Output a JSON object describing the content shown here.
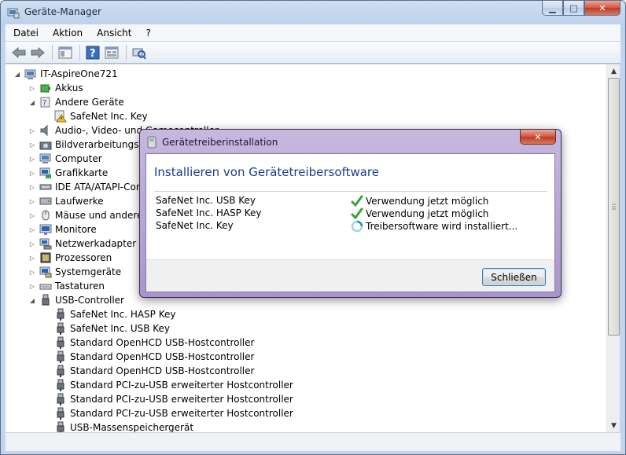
{
  "window": {
    "title": "Geräte-Manager",
    "controls": [
      "minimize-icon",
      "maximize-icon",
      "close-icon"
    ]
  },
  "menu": [
    "Datei",
    "Aktion",
    "Ansicht",
    "?"
  ],
  "toolbar": [
    "back-icon",
    "forward-icon",
    "properties-icon",
    "help-icon",
    "show-hidden-icon",
    "scan-hardware-icon"
  ],
  "tree": {
    "root": "IT-AspireOne721",
    "nodes": [
      {
        "label": "Akkus",
        "icon": "battery-icon",
        "expanded": false
      },
      {
        "label": "Andere Geräte",
        "icon": "unknown-device-icon",
        "expanded": true,
        "children": [
          {
            "label": "SafeNet Inc. Key",
            "icon": "warning-device-icon"
          }
        ]
      },
      {
        "label": "Audio-, Video- und Gamecontroller",
        "icon": "speaker-icon",
        "expanded": false
      },
      {
        "label": "Bildverarbeitungsgeräte",
        "icon": "camera-icon",
        "expanded": false
      },
      {
        "label": "Computer",
        "icon": "computer-icon",
        "expanded": false
      },
      {
        "label": "Grafikkarte",
        "icon": "display-adapter-icon",
        "expanded": false
      },
      {
        "label": "IDE ATA/ATAPI-Controller",
        "icon": "ide-controller-icon",
        "expanded": false
      },
      {
        "label": "Laufwerke",
        "icon": "disk-drive-icon",
        "expanded": false
      },
      {
        "label": "Mäuse und andere Zeigegeräte",
        "icon": "mouse-icon",
        "expanded": false
      },
      {
        "label": "Monitore",
        "icon": "monitor-icon",
        "expanded": false
      },
      {
        "label": "Netzwerkadapter",
        "icon": "network-adapter-icon",
        "expanded": false
      },
      {
        "label": "Prozessoren",
        "icon": "processor-icon",
        "expanded": false
      },
      {
        "label": "Systemgeräte",
        "icon": "system-device-icon",
        "expanded": false
      },
      {
        "label": "Tastaturen",
        "icon": "keyboard-icon",
        "expanded": false
      },
      {
        "label": "USB-Controller",
        "icon": "usb-icon",
        "expanded": true,
        "children": [
          {
            "label": "SafeNet Inc. HASP Key",
            "icon": "usb-plug-icon"
          },
          {
            "label": "SafeNet Inc. USB Key",
            "icon": "usb-plug-icon"
          },
          {
            "label": "Standard OpenHCD USB-Hostcontroller",
            "icon": "usb-plug-icon"
          },
          {
            "label": "Standard OpenHCD USB-Hostcontroller",
            "icon": "usb-plug-icon"
          },
          {
            "label": "Standard OpenHCD USB-Hostcontroller",
            "icon": "usb-plug-icon"
          },
          {
            "label": "Standard PCI-zu-USB erweiterter Hostcontroller",
            "icon": "usb-plug-icon"
          },
          {
            "label": "Standard PCI-zu-USB erweiterter Hostcontroller",
            "icon": "usb-plug-icon"
          },
          {
            "label": "Standard PCI-zu-USB erweiterter Hostcontroller",
            "icon": "usb-plug-icon"
          },
          {
            "label": "USB-Massenspeichergerät",
            "icon": "usb-plug-icon"
          }
        ]
      }
    ]
  },
  "dialog": {
    "title": "Gerätetreiberinstallation",
    "heading": "Installieren von Gerätetreibersoftware",
    "devices": [
      {
        "name": "SafeNet Inc. USB Key",
        "status": "Verwendung jetzt möglich",
        "status_icon": "check-icon"
      },
      {
        "name": "SafeNet Inc. HASP Key",
        "status": "Verwendung jetzt möglich",
        "status_icon": "check-icon"
      },
      {
        "name": "SafeNet Inc. Key",
        "status": "Treibersoftware wird installiert...",
        "status_icon": "spinner-icon"
      }
    ],
    "close_button": "Schließen"
  },
  "colors": {
    "dialog_heading": "#1a3b8f",
    "check": "#3aa335",
    "dialog_frame": "#a894cc"
  }
}
